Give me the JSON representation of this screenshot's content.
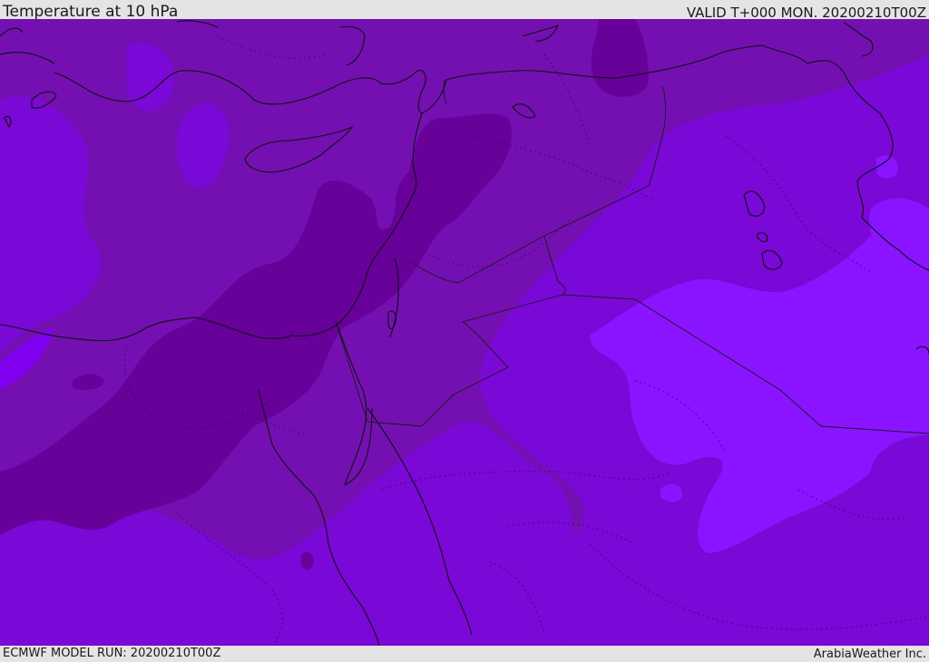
{
  "header": {
    "title": "Temperature at 10 hPa",
    "valid": "VALID T+000 MON. 20200210T00Z"
  },
  "footer": {
    "model_run": "ECMWF MODEL RUN: 20200210T00Z",
    "credit": "ArabiaWeather Inc."
  },
  "map": {
    "region": "Eastern Mediterranean / Middle East",
    "colors": {
      "darkest": "#68009a",
      "dark": "#7410b2",
      "mid": "#7a08d6",
      "light": "#8000f0",
      "lightest": "#8a14ff",
      "coast": "#111111",
      "border": "#1a1a1a"
    }
  }
}
